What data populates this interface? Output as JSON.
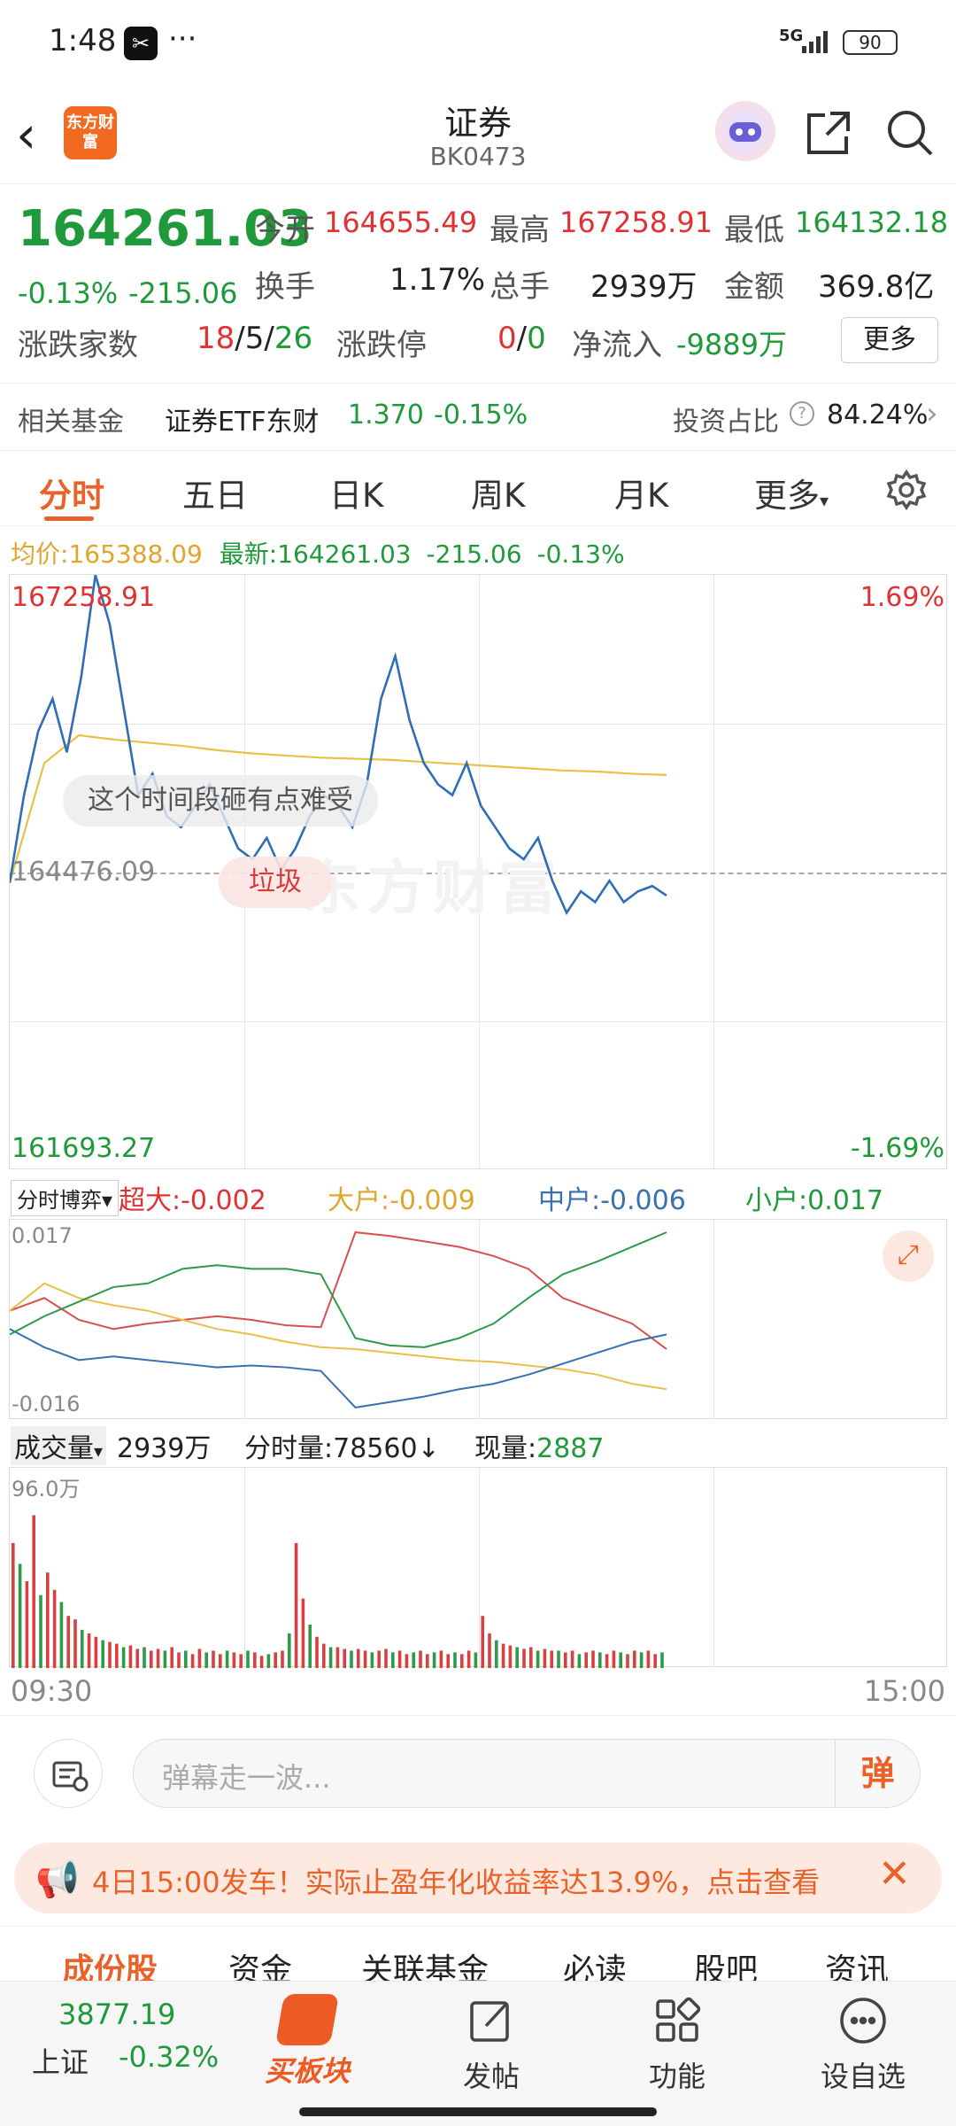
{
  "status": {
    "time": "1:48",
    "network": "5G",
    "battery": "90"
  },
  "header": {
    "title": "证券",
    "code": "BK0473",
    "logo_text": "东方财富"
  },
  "quote": {
    "price": "164261.03",
    "change_pct": "-0.13%",
    "change": "-215.06",
    "open_label": "今开",
    "open": "164655.49",
    "high_label": "最高",
    "high": "167258.91",
    "low_label": "最低",
    "low": "164132.18",
    "turnover_label": "换手",
    "turnover": "1.17%",
    "volume_label": "总手",
    "volume": "2939万",
    "amount_label": "金额",
    "amount": "369.8亿",
    "breadth_label": "涨跌家数",
    "breadth_up": "18",
    "breadth_flat": "5",
    "breadth_down": "26",
    "limit_label": "涨跌停",
    "limit_up": "0",
    "limit_down": "0",
    "netflow_label": "净流入",
    "netflow": "-9889万",
    "more_label": "更多"
  },
  "fund": {
    "label": "相关基金",
    "name": "证券ETF东财",
    "price": "1.370",
    "change": "-0.15%",
    "ratio_label": "投资占比",
    "ratio": "84.24%"
  },
  "tabs": [
    "分时",
    "五日",
    "日K",
    "周K",
    "月K",
    "更多"
  ],
  "chart_info": {
    "avg_label": "均价:",
    "avg": "165388.09",
    "latest_label": "最新:",
    "latest": "164261.03",
    "change": "-215.06",
    "change_pct": "-0.13%"
  },
  "main_chart": {
    "max": "167258.91",
    "mid": "164476.09",
    "min": "161693.27",
    "max_pct": "1.69%",
    "min_pct": "-1.69%",
    "danmu1": "这个时间段砸有点难受",
    "danmu2": "垃圾",
    "watermark": "东方财富"
  },
  "flow_chart": {
    "selector": "分时博弈",
    "super_label": "超大:",
    "super": "-0.002",
    "large_label": "大户:",
    "large": "-0.009",
    "mid_label": "中户:",
    "mid": "-0.006",
    "small_label": "小户:",
    "small": "0.017",
    "ymax": "0.017",
    "ymin": "-0.016"
  },
  "volume_chart": {
    "selector": "成交量",
    "total": "2939万",
    "tick_label": "分时量:",
    "tick": "78560↓",
    "now_label": "现量:",
    "now": "2887",
    "ymax": "96.0万",
    "start_time": "09:30",
    "end_time": "15:00"
  },
  "comment": {
    "placeholder": "弹幕走一波...",
    "send": "弹"
  },
  "banner": {
    "text": "4日15:00发车！实际止盈年化收益率达13.9%，点击查看"
  },
  "subtabs": [
    "成份股",
    "资金",
    "关联基金",
    "必读",
    "股吧",
    "资讯"
  ],
  "bottom": {
    "index_value": "3877.19",
    "index_name": "上证",
    "index_change": "-0.32%",
    "buy": "买板块",
    "post": "发帖",
    "func": "功能",
    "watch": "设自选"
  },
  "chart_data": {
    "type": "line",
    "x_range": [
      "09:30",
      "15:00"
    ],
    "ylim": [
      161693.27,
      167258.91
    ],
    "series": [
      {
        "name": "price",
        "values": [
          164380,
          165200,
          165800,
          166100,
          165600,
          166300,
          167258,
          166800,
          166000,
          165200,
          165400,
          165000,
          164900,
          165100,
          165300,
          165000,
          164700,
          164600,
          164800,
          164500,
          164700,
          165000,
          165200,
          165100,
          164900,
          165300,
          166100,
          166500,
          165900,
          165500,
          165300,
          165200,
          165500,
          165100,
          164900,
          164700,
          164600,
          164800,
          164400,
          164100,
          164300,
          164200,
          164400,
          164200,
          164300,
          164350,
          164261
        ]
      },
      {
        "name": "avg",
        "values": [
          164380,
          165500,
          165760,
          165720,
          165690,
          165660,
          165620,
          165590,
          165570,
          165550,
          165540,
          165530,
          165510,
          165490,
          165470,
          165450,
          165430,
          165420,
          165400,
          165388
        ]
      }
    ]
  }
}
